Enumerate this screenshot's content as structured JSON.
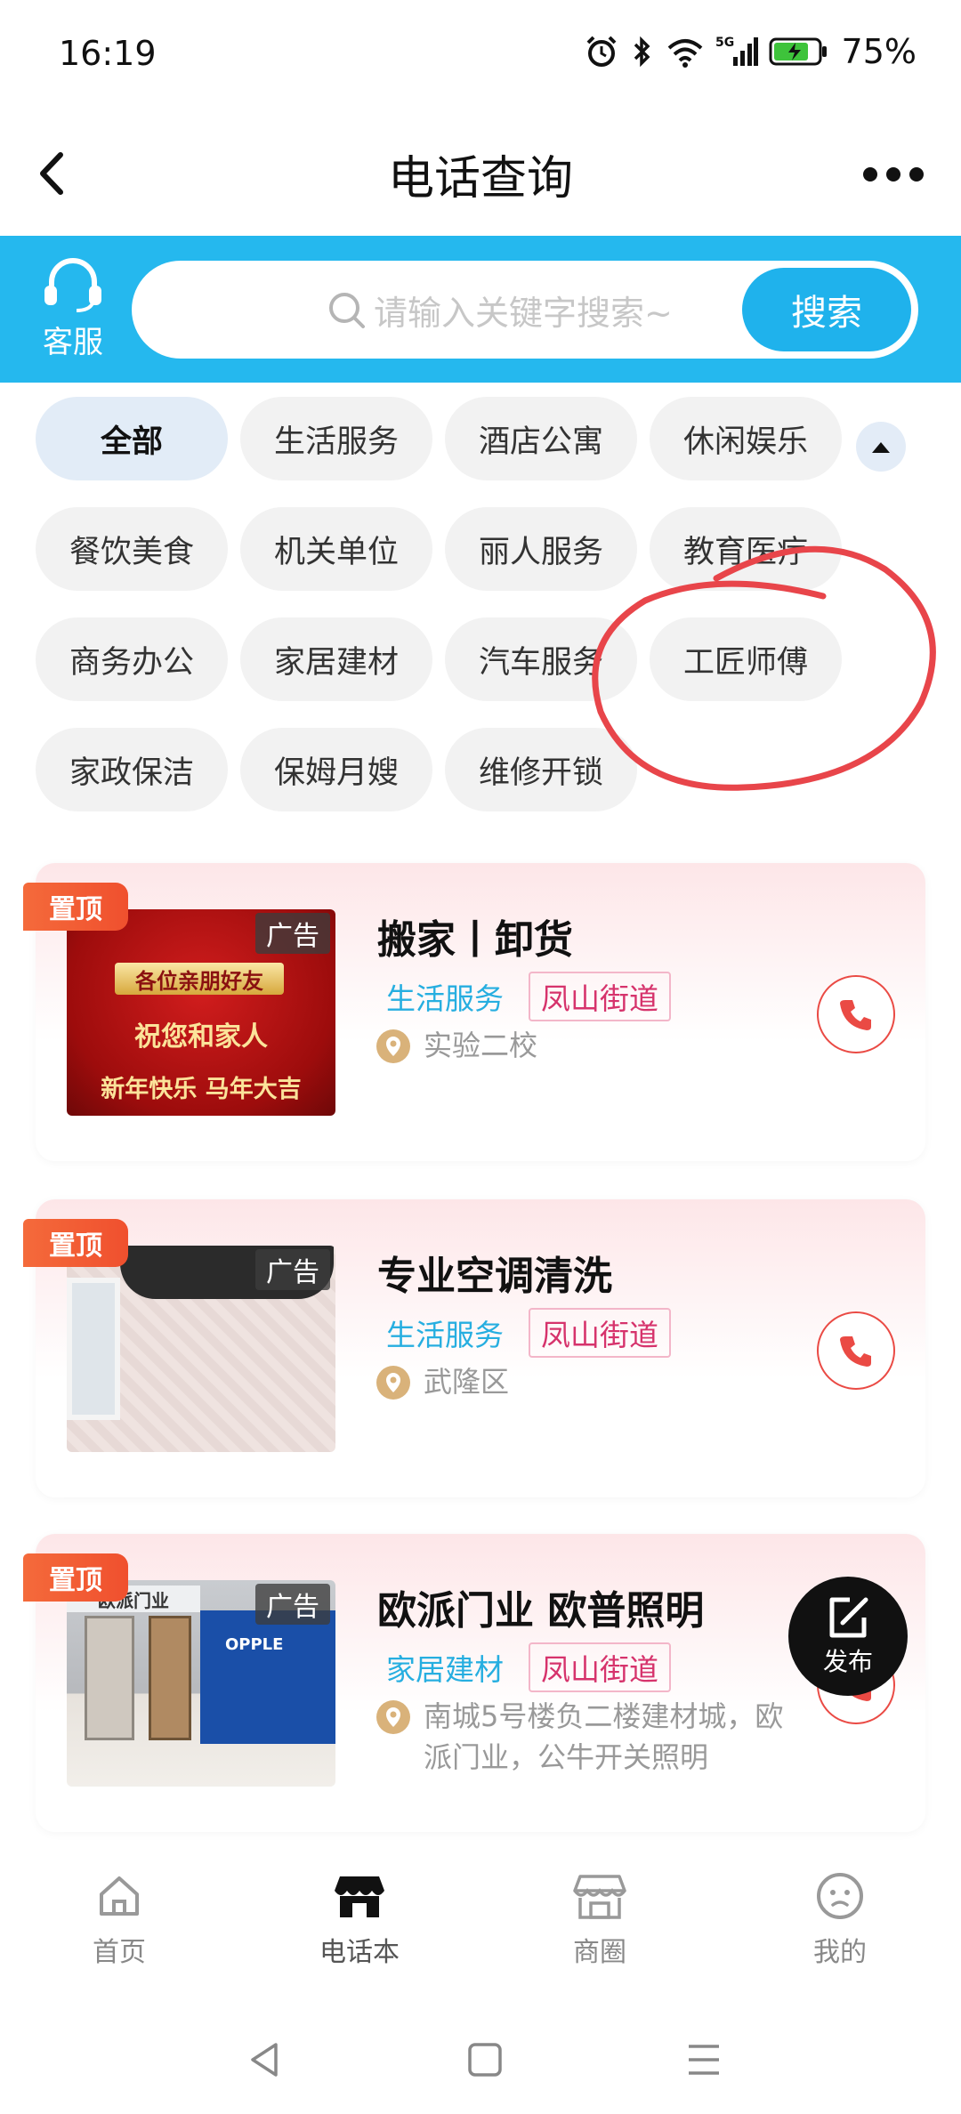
{
  "status_bar": {
    "time": "16:19",
    "battery": "75%"
  },
  "nav": {
    "title": "电话查询"
  },
  "search": {
    "service_label": "客服",
    "placeholder": "请输入关键字搜索~",
    "button": "搜索"
  },
  "categories": [
    "全部",
    "生活服务",
    "酒店公寓",
    "休闲娱乐",
    "餐饮美食",
    "机关单位",
    "丽人服务",
    "教育医疗",
    "商务办公",
    "家居建材",
    "汽车服务",
    "工匠师傅",
    "家政保洁",
    "保姆月嫂",
    "维修开锁"
  ],
  "listings": [
    {
      "pin": "置顶",
      "ad": "广告",
      "title": "搬家丨卸货",
      "category": "生活服务",
      "area": "凤山街道",
      "address": "实验二校",
      "image_text": [
        "各位亲朋好友",
        "祝您和家人",
        "新年快乐 马年大吉"
      ]
    },
    {
      "pin": "置顶",
      "ad": "广告",
      "title": "专业空调清洗",
      "category": "生活服务",
      "area": "凤山街道",
      "address": "武隆区"
    },
    {
      "pin": "置顶",
      "ad": "广告",
      "title": "欧派门业 欧普照明",
      "category": "家居建材",
      "area": "凤山街道",
      "address": "南城5号楼负二楼建材城，欧派门业，公牛开关照明",
      "image_text": [
        "欧派门业",
        "OPPLE"
      ]
    }
  ],
  "publish": {
    "label": "发布"
  },
  "tabs": [
    {
      "label": "首页",
      "icon": "home-icon"
    },
    {
      "label": "电话本",
      "icon": "store-icon",
      "active": true
    },
    {
      "label": "商圈",
      "icon": "shop-icon"
    },
    {
      "label": "我的",
      "icon": "face-icon"
    }
  ],
  "colors": {
    "accent": "#25b8ee",
    "pin": "#f0502e",
    "call": "#ea4a44",
    "annotation": "#e8454a"
  }
}
